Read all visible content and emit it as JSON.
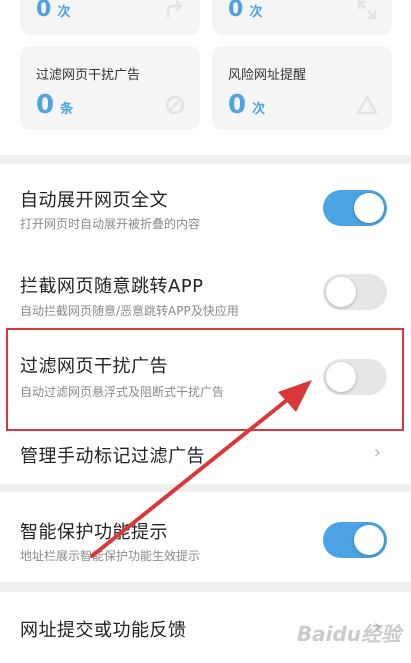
{
  "stats": {
    "top_left": {
      "value": "0",
      "unit": "次",
      "icon": "share-arrow-icon"
    },
    "top_right": {
      "value": "0",
      "unit": "次",
      "icon": "expand-icon"
    },
    "ad_filter": {
      "label": "过滤网页干扰广告",
      "value": "0",
      "unit": "条",
      "icon": "block-icon"
    },
    "risk_alert": {
      "label": "风险网址提醒",
      "value": "0",
      "unit": "次",
      "icon": "warning-triangle-icon"
    }
  },
  "settings": {
    "auto_expand": {
      "title": "自动展开网页全文",
      "subtitle": "打开网页时自动展开被折叠的内容",
      "enabled": true
    },
    "block_redirect": {
      "title": "拦截网页随意跳转APP",
      "subtitle": "自动拦截网页随意/恶意跳转APP及快应用",
      "enabled": false
    },
    "filter_ads": {
      "title": "过滤网页干扰广告",
      "subtitle": "自动过滤网页悬浮式及阻断式干扰广告",
      "enabled": false
    },
    "manage_marked": {
      "title": "管理手动标记过滤广告"
    },
    "smart_protect": {
      "title": "智能保护功能提示",
      "subtitle": "地址栏展示智能保护功能生效提示",
      "enabled": true
    },
    "feedback": {
      "title": "网址提交或功能反馈"
    }
  },
  "watermark": "Baidu经验",
  "colors": {
    "accent": "#4ba3e3",
    "annotation": "#d9383a"
  }
}
